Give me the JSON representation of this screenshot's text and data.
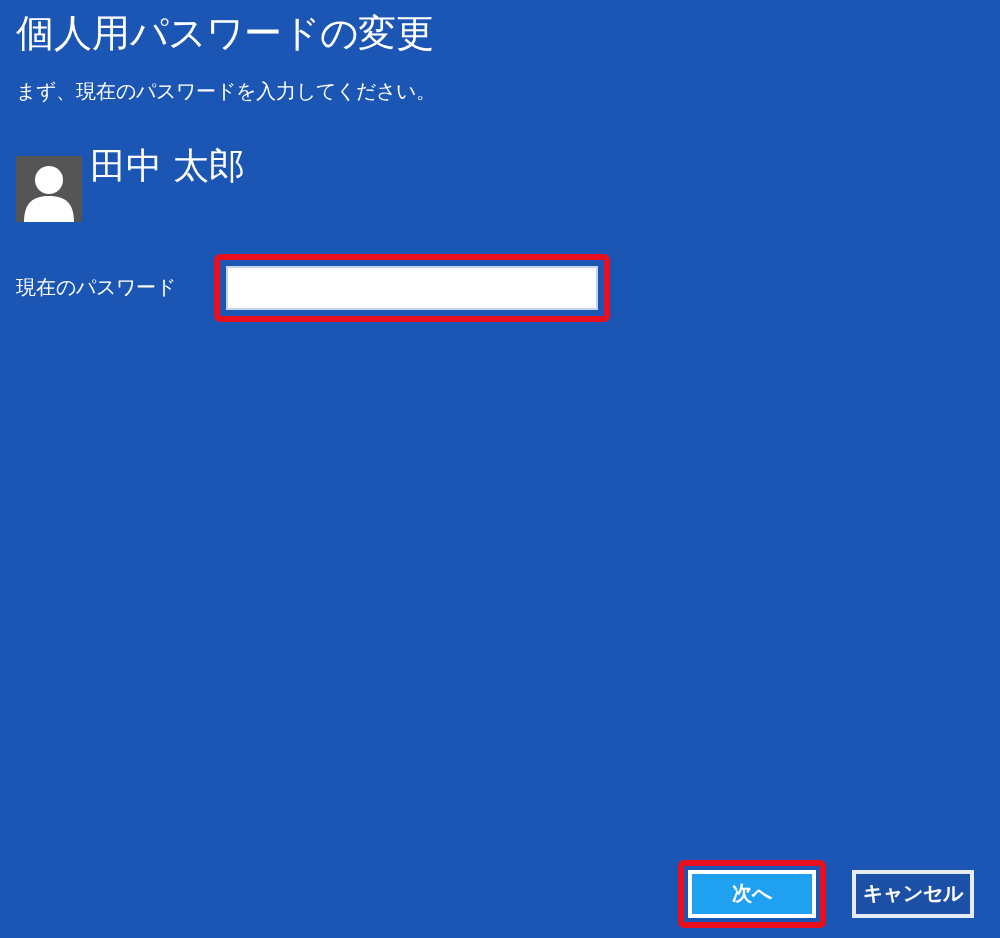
{
  "title": "個人用パスワードの変更",
  "instruction": "まず、現在のパスワードを入力してください。",
  "user": {
    "name": "田中 太郎"
  },
  "password_field": {
    "label": "現在のパスワード",
    "highlighted": true
  },
  "buttons": [
    {
      "label": "次へ",
      "kind": "primary",
      "highlighted": true
    },
    {
      "label": "キャンセル",
      "kind": "secondary",
      "highlighted": false
    }
  ]
}
